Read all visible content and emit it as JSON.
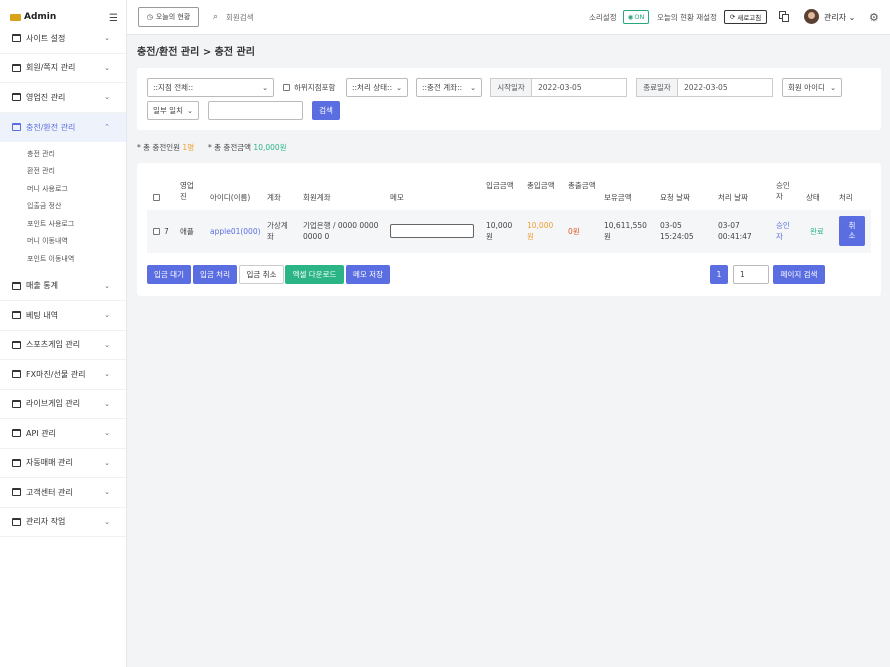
{
  "sidebar": {
    "logo": "Admin",
    "items": [
      {
        "label": "사이트 설정"
      },
      {
        "label": "회원/쪽지 관리"
      },
      {
        "label": "영업진 관리"
      },
      {
        "label": "충전/환전 관리"
      },
      {
        "label": "매출 통계"
      },
      {
        "label": "베팅 내역"
      },
      {
        "label": "스포츠게임 관리"
      },
      {
        "label": "FX마진/선물 관리"
      },
      {
        "label": "라이브게임 관리"
      },
      {
        "label": "API 관리"
      },
      {
        "label": "자동매매 관리"
      },
      {
        "label": "고객센터 관리"
      },
      {
        "label": "관리자 작업"
      }
    ],
    "subitems": [
      "충전 관리",
      "환전 관리",
      "머니 사용로그",
      "입출금 정산",
      "포인트 사용로그",
      "머니 이동내역",
      "포인트 이동내역"
    ]
  },
  "topbar": {
    "today_btn": "오늘의 현황",
    "search_placeholder": "회원검색",
    "sound_label": "소리설정",
    "sound_state": "ON",
    "reset_label": "오늘의 현황 재설정",
    "refresh_btn": "새로고침",
    "admin_label": "관리자"
  },
  "page": {
    "title": "충전/환전 관리 > 충전 관리"
  },
  "filters": {
    "branch": "::지점 전체::",
    "include_sub": "하위지점포함",
    "status": "::처리 상태::",
    "account": "::충전 계좌::",
    "start_label": "시작일자",
    "start_date": "2022-03-05",
    "end_label": "종료일자",
    "end_date": "2022-03-05",
    "member_id": "회원 아이디",
    "match": "일부 일치",
    "search_btn": "검색"
  },
  "summary": {
    "count_label": "* 총 충전인원",
    "count_value": "1명",
    "amount_label": "* 총 충전금액",
    "amount_value": "10,000원"
  },
  "table": {
    "headers": {
      "sales": "영업진",
      "id": "아이디(이름)",
      "account": "계좌",
      "member_account": "회원계좌",
      "memo": "메모",
      "deposit": "입금금액",
      "total_deposit": "총입금액",
      "total_withdraw": "총출금액",
      "balance": "보유금액",
      "request_date": "요청 날짜",
      "process_date": "처리 날짜",
      "approver": "승인자",
      "state": "상태",
      "action": "처리"
    },
    "row": {
      "no": "7",
      "sales": "애플",
      "id": "apple01(000)",
      "account": "가상계좌",
      "member_account": "기업은행 / 0000 0000 0000 0",
      "deposit": "10,000원",
      "total_deposit": "10,000원",
      "total_withdraw": "0원",
      "balance": "10,611,550원",
      "request_date": "03-05 15:24:05",
      "process_date": "03-07 00:41:47",
      "approver": "승인자",
      "state": "완료",
      "action": "취소"
    }
  },
  "actions": {
    "wait": "입금 대기",
    "process": "입금 처리",
    "cancel": "입금 취소",
    "excel": "엑셀 다운로드",
    "memo_save": "메모 저장",
    "page_current": "1",
    "page_input": "1",
    "page_search": "페이지 검색"
  },
  "colors": {
    "primary": "#5b6ee1",
    "success": "#2bb586",
    "orange": "#f0a030",
    "red": "#e0572b"
  }
}
